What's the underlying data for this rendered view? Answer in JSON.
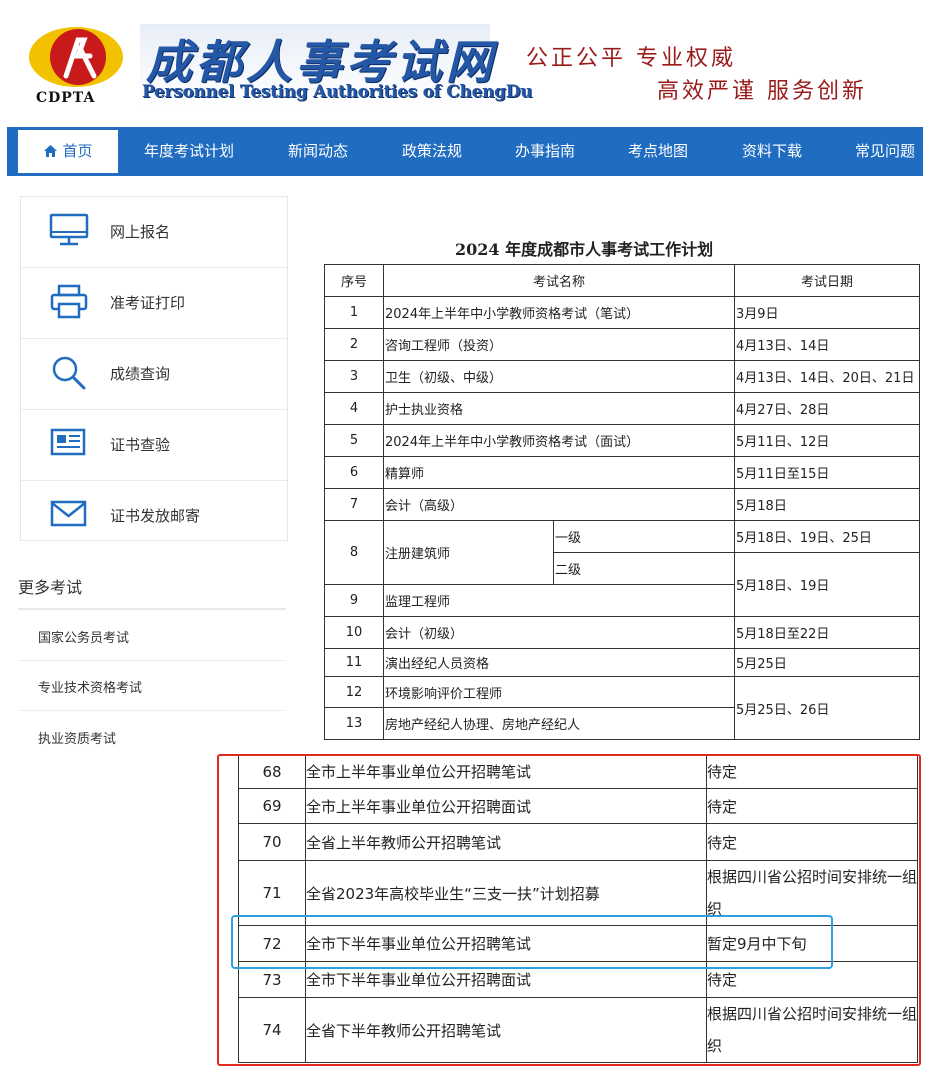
{
  "header": {
    "logo_abbr": "CDPTA",
    "title_cn": "成都人事考试网",
    "title_en": "Personnel Testing Authorities of ChengDu",
    "slogan_1": "公正公平 专业权威",
    "slogan_2": "高效严谨 服务创新"
  },
  "nav": {
    "items": [
      "首页",
      "年度考试计划",
      "新闻动态",
      "政策法规",
      "办事指南",
      "考点地图",
      "资料下载",
      "常见问题"
    ],
    "active": "首页"
  },
  "sidebar": {
    "quick_links": [
      "网上报名",
      "准考证打印",
      "成绩查询",
      "证书查验",
      "证书发放邮寄"
    ],
    "more_title": "更多考试",
    "more_links": [
      "国家公务员考试",
      "专业技术资格考试",
      "执业资质考试"
    ]
  },
  "plan_table": {
    "title": "2024 年度成都市人事考试工作计划",
    "headers": [
      "序号",
      "考试名称",
      "考试日期"
    ],
    "rows": [
      {
        "no": "1",
        "name": "2024年上半年中小学教师资格考试（笔试）",
        "date": "3月9日"
      },
      {
        "no": "2",
        "name": "咨询工程师（投资）",
        "date": "4月13日、14日"
      },
      {
        "no": "3",
        "name": "卫生（初级、中级）",
        "date": "4月13日、14日、20日、21日"
      },
      {
        "no": "4",
        "name": "护士执业资格",
        "date": "4月27日、28日"
      },
      {
        "no": "5",
        "name": "2024年上半年中小学教师资格考试（面试）",
        "date": "5月11日、12日"
      },
      {
        "no": "6",
        "name": "精算师",
        "date": "5月11日至15日"
      },
      {
        "no": "7",
        "name": "会计（高级）",
        "date": "5月18日"
      },
      {
        "no": "8",
        "name": "注册建筑师",
        "sub1": "一级",
        "sub2": "二级",
        "date": "5月18日、19日、25日",
        "date2": "5月18日、19日"
      },
      {
        "no": "9",
        "name": "监理工程师"
      },
      {
        "no": "10",
        "name": "会计（初级）",
        "date": "5月18日至22日"
      },
      {
        "no": "11",
        "name": "演出经纪人员资格",
        "date": "5月25日"
      },
      {
        "no": "12",
        "name": "环境影响评价工程师",
        "date": "5月25日、26日"
      },
      {
        "no": "13",
        "name": "房地产经纪人协理、房地产经纪人"
      }
    ]
  },
  "recruit_table": {
    "rows": [
      {
        "no": "68",
        "name": "全市上半年事业单位公开招聘笔试",
        "date": "待定"
      },
      {
        "no": "69",
        "name": "全市上半年事业单位公开招聘面试",
        "date": "待定"
      },
      {
        "no": "70",
        "name": "全省上半年教师公开招聘笔试",
        "date": "待定"
      },
      {
        "no": "71",
        "name": "全省2023年高校毕业生“三支一扶”计划招募",
        "date": "根据四川省公招时间安排统一组织"
      },
      {
        "no": "72",
        "name": "全市下半年事业单位公开招聘笔试",
        "date": "暂定9月中下旬"
      },
      {
        "no": "73",
        "name": "全市下半年事业单位公开招聘面试",
        "date": "待定"
      },
      {
        "no": "74",
        "name": "全省下半年教师公开招聘笔试",
        "date": "根据四川省公招时间安排统一组织"
      }
    ]
  },
  "colors": {
    "nav_bg": "#1f6cc1",
    "slogan": "#9b1b1b",
    "title_blue": "#2457a6",
    "highlight_red": "#e02a1f",
    "highlight_blue": "#2b9fe0",
    "icon_blue": "#1f6cc1"
  }
}
